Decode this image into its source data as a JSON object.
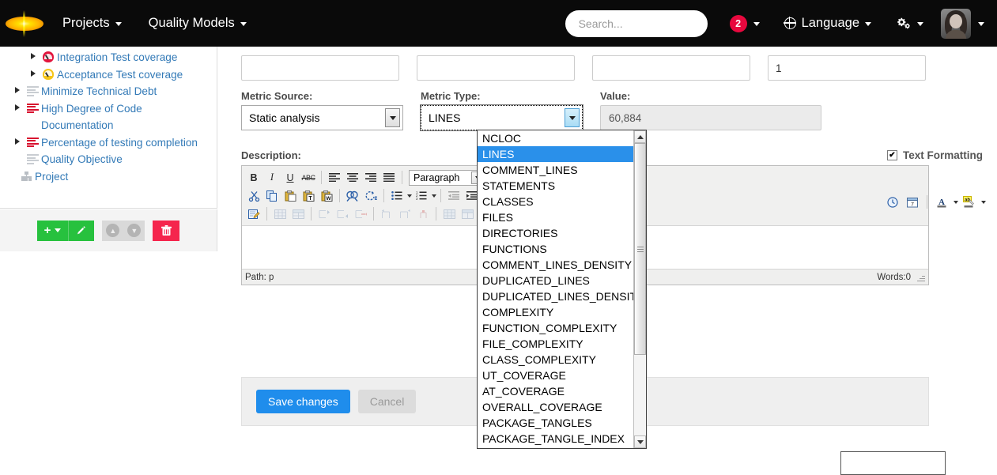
{
  "navbar": {
    "brand_name": "app-logo",
    "menus": [
      {
        "label": "Projects"
      },
      {
        "label": "Quality Models"
      }
    ],
    "search_placeholder": "Search...",
    "search_value": "",
    "notification_count": "2",
    "language_label": "Language",
    "settings_icon": "gears-icon",
    "avatar_alt": "user-avatar"
  },
  "sidebar": {
    "tree": [
      {
        "label": "Integration Test coverage",
        "icon": "gauge-red-icon",
        "expandable": true,
        "indent": 1
      },
      {
        "label": "Acceptance Test coverage",
        "icon": "gauge-yellow-icon",
        "expandable": true,
        "indent": 1
      },
      {
        "label": "Minimize Technical Debt",
        "icon": "doc-lines-grey-icon",
        "expandable": true,
        "indent": 0
      },
      {
        "label": "High Degree of Code Documentation",
        "icon": "doc-lines-red-icon",
        "expandable": true,
        "indent": 0
      },
      {
        "label": "Percentage of testing completion",
        "icon": "doc-lines-red-icon",
        "expandable": true,
        "indent": 0
      },
      {
        "label": "Quality Objective",
        "icon": "doc-lines-grey-icon",
        "expandable": false,
        "indent": 0
      },
      {
        "label": "Project",
        "icon": "org-chart-icon",
        "expandable": false,
        "indent": -1
      }
    ],
    "toolbar": {
      "add_label": "+",
      "edit_label": "edit-pencil",
      "move_up_label": "move-up",
      "move_down_label": "move-down",
      "delete_label": "delete"
    }
  },
  "form": {
    "top_inputs": [
      {
        "label": "",
        "value": ""
      },
      {
        "label": "",
        "value": ""
      },
      {
        "label": "",
        "value": ""
      },
      {
        "label": "",
        "value": "1"
      }
    ],
    "metric_source": {
      "label": "Metric Source:",
      "value": "Static analysis"
    },
    "metric_type": {
      "label": "Metric Type:",
      "value": "LINES"
    },
    "value_field": {
      "label": "Value:",
      "value": "60,884"
    },
    "description_label": "Description:",
    "text_formatting_label": "Text Formatting",
    "text_formatting_checked": "✔"
  },
  "editor": {
    "row1": [
      {
        "name": "bold-icon",
        "glyph": "B"
      },
      {
        "name": "italic-icon",
        "glyph": "I"
      },
      {
        "name": "underline-icon",
        "glyph": "U"
      },
      {
        "name": "strikethrough-icon",
        "glyph": "ABC"
      },
      {
        "name": "align-left-icon",
        "glyph": "≡"
      },
      {
        "name": "align-center-icon",
        "glyph": "≡"
      },
      {
        "name": "align-right-icon",
        "glyph": "≡"
      },
      {
        "name": "align-justify-icon",
        "glyph": "≡"
      }
    ],
    "format_select_value": "Paragraph",
    "row2": [
      {
        "name": "cut-icon",
        "glyph": "✂"
      },
      {
        "name": "copy-icon",
        "glyph": "⧉"
      },
      {
        "name": "paste-icon",
        "glyph": "📋"
      },
      {
        "name": "paste-as-text-icon",
        "glyph": "T"
      },
      {
        "name": "paste-from-word-icon",
        "glyph": "W"
      },
      {
        "name": "find-icon",
        "glyph": "🔍"
      },
      {
        "name": "find-replace-icon",
        "glyph": "↻"
      },
      {
        "name": "bullet-list-icon",
        "glyph": "☰"
      },
      {
        "name": "numbered-list-icon",
        "glyph": "☰"
      },
      {
        "name": "outdent-icon",
        "glyph": "⇤"
      },
      {
        "name": "indent-icon",
        "glyph": "⇥"
      }
    ],
    "row3": [
      {
        "name": "edit-source-icon",
        "glyph": "✎"
      },
      {
        "name": "table-icon",
        "glyph": "▦"
      },
      {
        "name": "table-props-icon",
        "glyph": "▤"
      },
      {
        "name": "insert-row-before-icon",
        "glyph": "⊐"
      },
      {
        "name": "insert-row-after-icon",
        "glyph": "⊐"
      },
      {
        "name": "delete-row-icon",
        "glyph": "⊐"
      },
      {
        "name": "insert-col-before-icon",
        "glyph": "⊓"
      },
      {
        "name": "insert-col-after-icon",
        "glyph": "⊓"
      },
      {
        "name": "delete-col-icon",
        "glyph": "⊤"
      },
      {
        "name": "merge-cells-icon",
        "glyph": "▦"
      },
      {
        "name": "split-cell-icon",
        "glyph": "▥"
      },
      {
        "name": "horizontal-rule-icon",
        "glyph": "—"
      }
    ],
    "row3_right": [
      {
        "name": "insert-time-icon",
        "glyph": "🕐"
      },
      {
        "name": "insert-date-icon",
        "glyph": "📅"
      },
      {
        "name": "text-color-icon",
        "glyph": "A"
      },
      {
        "name": "highlight-color-icon",
        "glyph": "ab"
      }
    ],
    "content": "",
    "status_path": "Path: p",
    "status_words": "Words:0"
  },
  "actions": {
    "save_label": "Save changes",
    "cancel_label": "Cancel"
  },
  "dropdown": {
    "selected": "LINES",
    "options": [
      "NCLOC",
      "LINES",
      "COMMENT_LINES",
      "STATEMENTS",
      "CLASSES",
      "FILES",
      "DIRECTORIES",
      "FUNCTIONS",
      "COMMENT_LINES_DENSITY",
      "DUPLICATED_LINES",
      "DUPLICATED_LINES_DENSITY",
      "COMPLEXITY",
      "FUNCTION_COMPLEXITY",
      "FILE_COMPLEXITY",
      "CLASS_COMPLEXITY",
      "UT_COVERAGE",
      "AT_COVERAGE",
      "OVERALL_COVERAGE",
      "PACKAGE_TANGLES",
      "PACKAGE_TANGLE_INDEX"
    ]
  },
  "colors": {
    "navbar_bg": "#0a0a0a",
    "brand_yellow": "#ffe000",
    "badge_red": "#e8083e",
    "link_blue": "#337ab7",
    "primary_blue": "#1f8dec",
    "select_highlight": "#2a90ea",
    "green": "#27c13e",
    "danger": "#f5254d"
  }
}
